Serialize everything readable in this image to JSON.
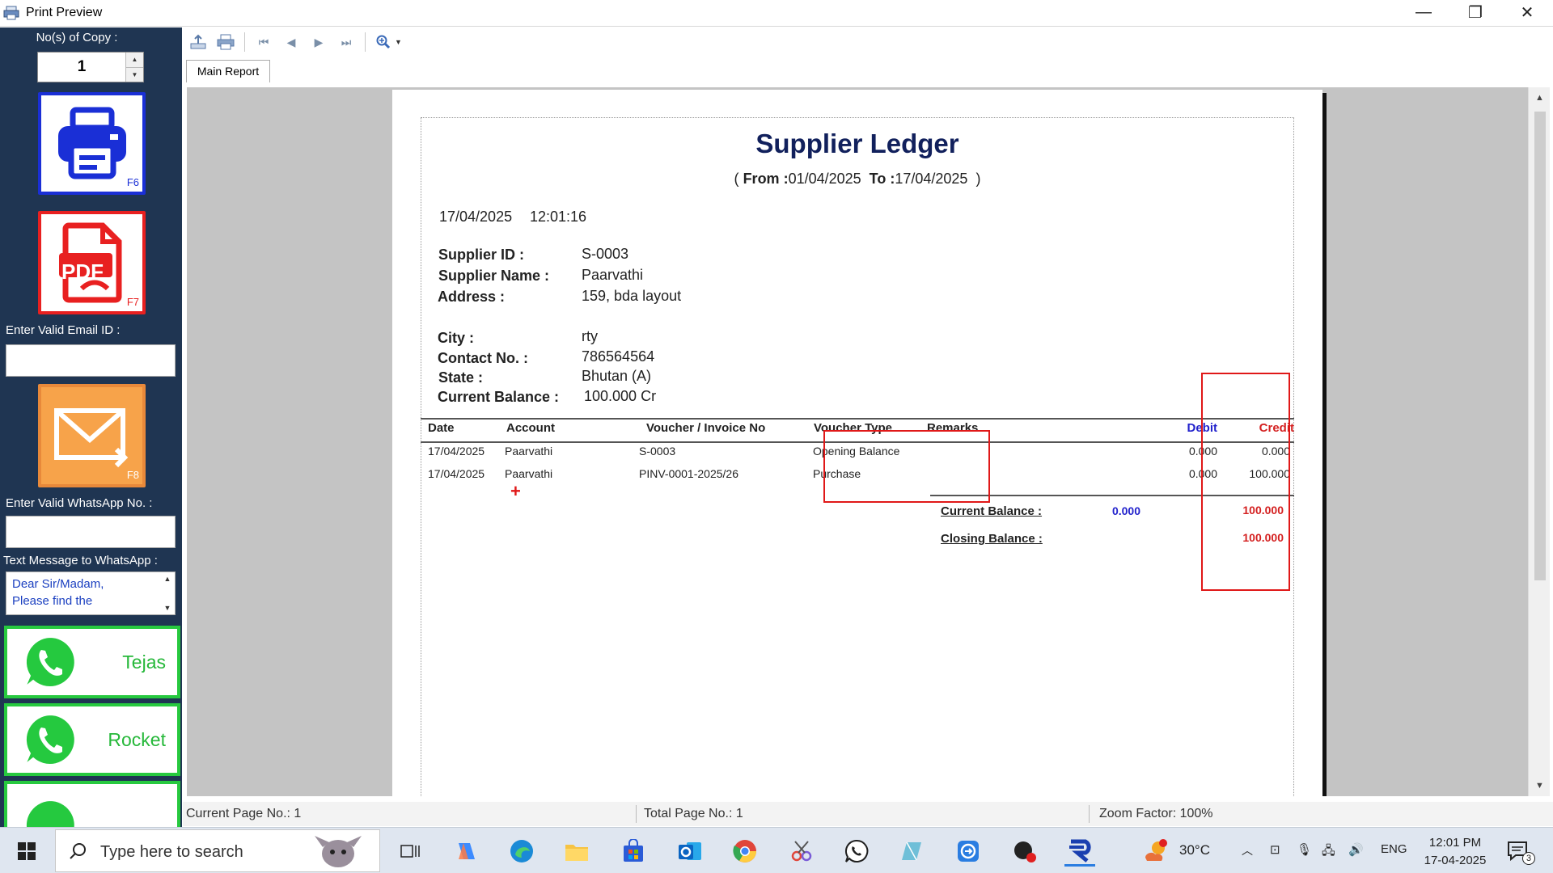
{
  "window": {
    "title": "Print Preview",
    "controls": {
      "minimize": "—",
      "restore": "❐",
      "close": "✕"
    }
  },
  "left_panel": {
    "copies_label": "No(s) of Copy :",
    "copies_value": "1",
    "print_key": "F6",
    "pdf_key": "F7",
    "pdf_text": "PDF",
    "email_label": "Enter Valid Email ID :",
    "email_value": "",
    "email_key": "F8",
    "whatsapp_no_label": "Enter Valid WhatsApp No. :",
    "whatsapp_no_value": "",
    "whatsapp_msg_label": "Text Message to WhatsApp :",
    "whatsapp_msg_value": "Dear Sir/Madam,\nPlease find the",
    "whatsapp_buttons": [
      "Tejas",
      "Rocket"
    ]
  },
  "toolbar": {
    "tab": "Main Report"
  },
  "report": {
    "title": "Supplier Ledger",
    "range": {
      "open": "(",
      "from_label": "From :",
      "from": "01/04/2025",
      "to_label": "To :",
      "to": "17/04/2025",
      "close": ")"
    },
    "date": "17/04/2025",
    "time": "12:01:16",
    "fields": [
      {
        "label": "Supplier ID :",
        "value": "S-0003"
      },
      {
        "label": "Supplier Name :",
        "value": "Paarvathi"
      },
      {
        "label": "Address :",
        "value": "159, bda layout"
      },
      {
        "label": "City :",
        "value": "rty"
      },
      {
        "label": "Contact No.    :",
        "value": "786564564"
      },
      {
        "label": "State    :",
        "value": "Bhutan (A)"
      },
      {
        "label": "Current Balance    :",
        "value": "100.000 Cr"
      }
    ],
    "columns": [
      "Date",
      "Account",
      "Voucher / Invoice No",
      "Voucher Type",
      "Remarks",
      "Debit",
      "Credit"
    ],
    "rows": [
      {
        "date": "17/04/2025",
        "account": "Paarvathi",
        "voucher": "S-0003",
        "type": "Opening Balance",
        "remarks": "",
        "debit": "0.000",
        "credit": "0.000"
      },
      {
        "date": "17/04/2025",
        "account": "Paarvathi",
        "voucher": "PINV-0001-2025/26",
        "type": "Purchase",
        "remarks": "",
        "debit": "0.000",
        "credit": "100.000"
      }
    ],
    "current_balance": {
      "label": "Current Balance :",
      "debit": "0.000",
      "credit": "100.000"
    },
    "closing_balance": {
      "label": "Closing Balance :",
      "credit": "100.000"
    }
  },
  "status": {
    "current_page": "Current Page No.: 1",
    "total_page": "Total Page No.: 1",
    "zoom": "Zoom Factor: 100%"
  },
  "taskbar": {
    "search_placeholder": "Type here to search",
    "weather": "30°C",
    "language": "ENG",
    "time": "12:01 PM",
    "date": "17-04-2025",
    "notifications": "3"
  },
  "colors": {
    "panel_bg": "#1f3552",
    "print_border": "#1a2fd6",
    "pdf_border": "#e82020",
    "email_bg": "#f7a34a",
    "whatsapp_green": "#27c93f",
    "report_title": "#11205c",
    "debit_blue": "#2222cc",
    "credit_red": "#d42020",
    "highlight_box": "#e01818"
  }
}
